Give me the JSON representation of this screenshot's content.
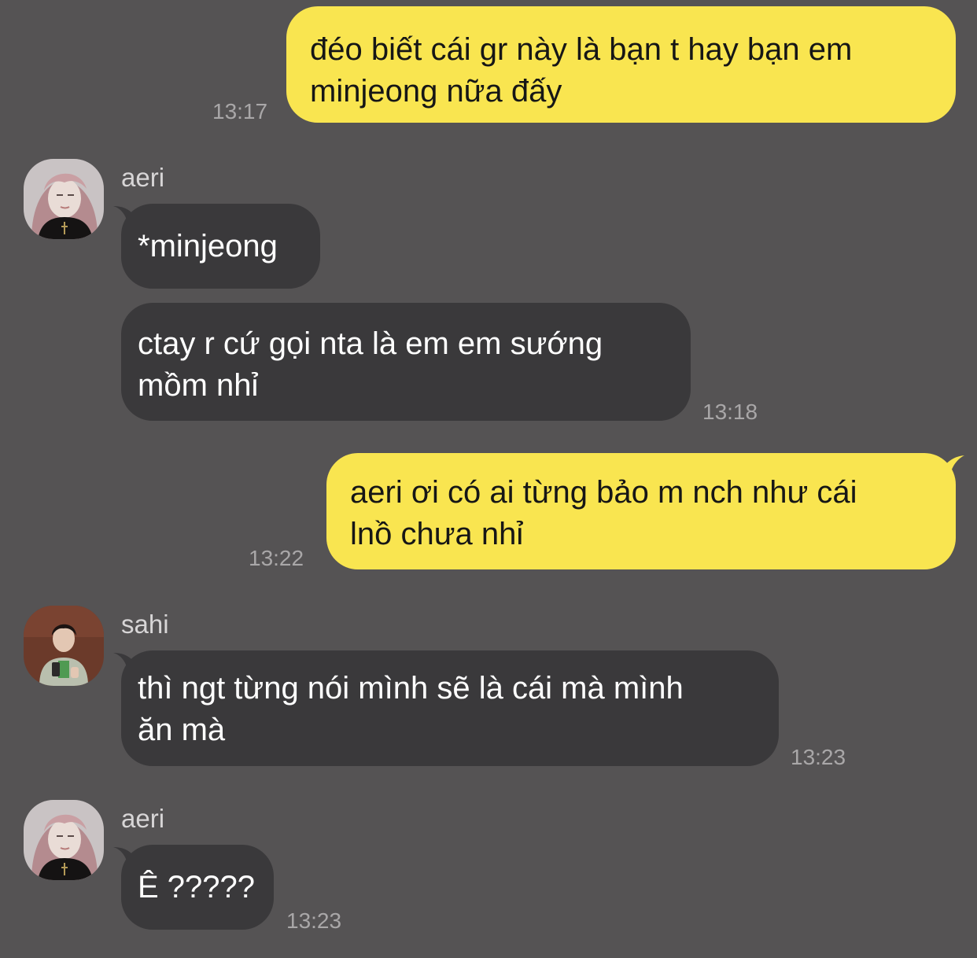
{
  "colors": {
    "background": "#555354",
    "outgoing_bubble": "#f9e550",
    "incoming_bubble": "#3a393b",
    "timestamp": "#a9a7a8",
    "sender_name": "#d7d5d6"
  },
  "messages": [
    {
      "direction": "outgoing",
      "lines": [
        "đéo biết cái gr này là bạn t hay bạn em",
        "minjeong nữa đấy"
      ],
      "time": "13:17"
    },
    {
      "direction": "incoming",
      "sender": "aeri",
      "avatar_icon": "aeri-avatar-icon",
      "lines": [
        "*minjeong"
      ],
      "time": ""
    },
    {
      "direction": "incoming",
      "sender": "aeri",
      "lines": [
        "ctay r cứ gọi nta là em em sướng",
        "mồm nhỉ"
      ],
      "time": "13:18"
    },
    {
      "direction": "outgoing",
      "lines": [
        "aeri ơi có ai từng bảo m nch như cái",
        "lnồ chưa nhỉ"
      ],
      "time": "13:22"
    },
    {
      "direction": "incoming",
      "sender": "sahi",
      "avatar_icon": "sahi-avatar-icon",
      "lines": [
        "thì ngt từng nói mình sẽ là cái mà mình",
        "ăn mà"
      ],
      "time": "13:23"
    },
    {
      "direction": "incoming",
      "sender": "aeri",
      "avatar_icon": "aeri-avatar-icon",
      "lines": [
        "Ê ?????"
      ],
      "time": "13:23"
    }
  ]
}
